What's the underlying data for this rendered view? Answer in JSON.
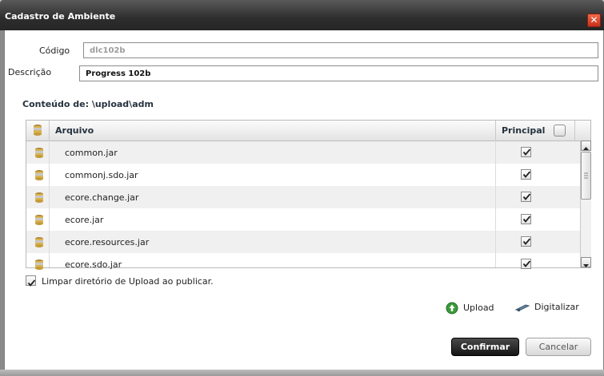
{
  "window": {
    "title": "Cadastro de Ambiente",
    "close_glyph": "✕"
  },
  "form": {
    "codigo_label": "Código",
    "codigo_value": "dlc102b",
    "descricao_label": "Descrição",
    "descricao_value": "Progress 102b"
  },
  "content_label": "Conteúdo de: \\upload\\adm",
  "grid": {
    "headers": {
      "file": "Arquivo",
      "principal": "Principal"
    },
    "rows": [
      {
        "name": "common.jar",
        "principal": true
      },
      {
        "name": "commonj.sdo.jar",
        "principal": true
      },
      {
        "name": "ecore.change.jar",
        "principal": true
      },
      {
        "name": "ecore.jar",
        "principal": true
      },
      {
        "name": "ecore.resources.jar",
        "principal": true
      },
      {
        "name": "ecore.sdo.jar",
        "principal": true
      }
    ]
  },
  "options": {
    "clean_upload_label": "Limpar diretório de Upload ao publicar.",
    "clean_upload_checked": true
  },
  "actions": {
    "upload_label": "Upload",
    "digitalizar_label": "Digitalizar"
  },
  "buttons": {
    "confirm_label": "Confirmar",
    "cancel_label": "Cancelar"
  },
  "colors": {
    "title_bar": "#2d2d2d",
    "confirm_bg": "#151515",
    "close_bg": "#d94025"
  }
}
